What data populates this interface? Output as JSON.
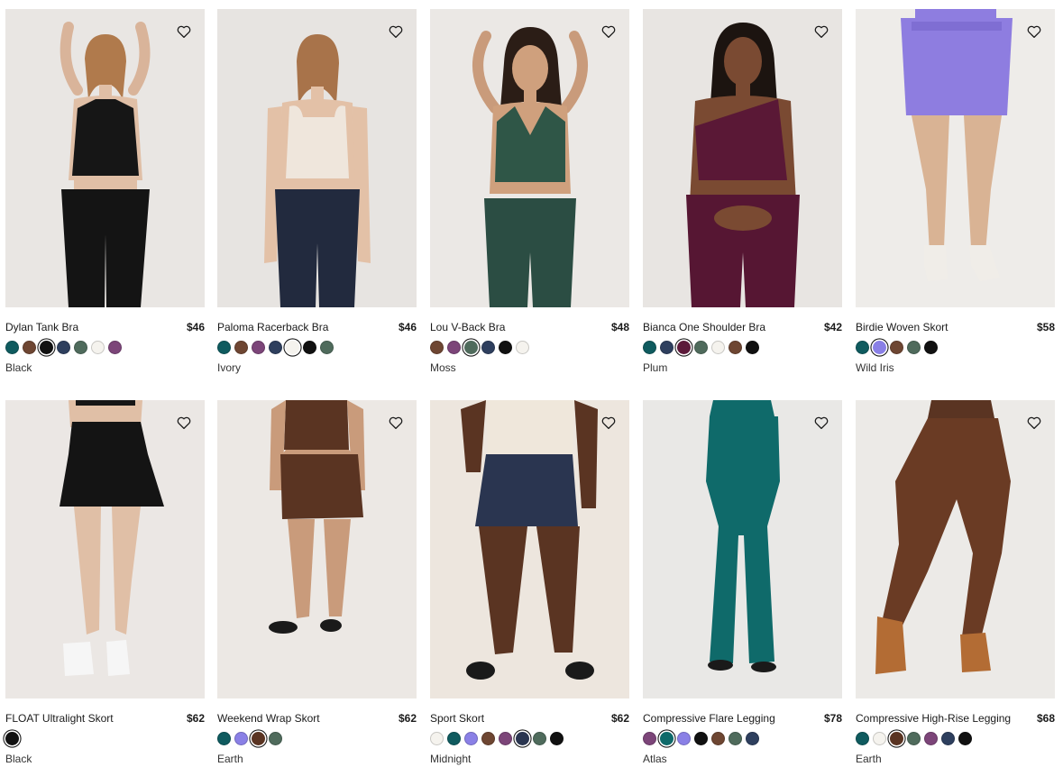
{
  "products": [
    {
      "name": "Dylan Tank Bra",
      "price": "$46",
      "color_name": "Black",
      "bg": "#e9e6e3",
      "swatches": [
        "#0f5b5f",
        "#6e4632",
        "#111111",
        "#2e3f5e",
        "#4f6b5c",
        "#f5f3ee",
        "#7c4579"
      ],
      "selected": 2
    },
    {
      "name": "Paloma Racerback Bra",
      "price": "$46",
      "color_name": "Ivory",
      "bg": "#e7e4e1",
      "swatches": [
        "#0f5b5f",
        "#6e4632",
        "#7c4579",
        "#2e3f5e",
        "#f5f3ee",
        "#111111",
        "#4f6b5c"
      ],
      "selected": 4
    },
    {
      "name": "Lou V-Back Bra",
      "price": "$48",
      "color_name": "Moss",
      "bg": "#ebe8e5",
      "swatches": [
        "#6e4632",
        "#7c4579",
        "#4f6b5c",
        "#2e3f5e",
        "#111111",
        "#f5f3ee"
      ],
      "selected": 2
    },
    {
      "name": "Bianca One Shoulder Bra",
      "price": "$42",
      "color_name": "Plum",
      "bg": "#e8e5e2",
      "swatches": [
        "#0f5b5f",
        "#2e3f5e",
        "#5c1a3a",
        "#4f6b5c",
        "#f5f3ee",
        "#6e4632",
        "#111111"
      ],
      "selected": 2
    },
    {
      "name": "Birdie Woven Skort",
      "price": "$58",
      "color_name": "Wild Iris",
      "bg": "#eeece9",
      "swatches": [
        "#0f5b5f",
        "#8a80e6",
        "#6e4632",
        "#4f6b5c",
        "#111111"
      ],
      "selected": 1
    },
    {
      "name": "FLOAT Ultralight Skort",
      "price": "$62",
      "color_name": "Black",
      "bg": "#ebe7e4",
      "swatches": [
        "#111111"
      ],
      "selected": 0
    },
    {
      "name": "Weekend Wrap Skort",
      "price": "$62",
      "color_name": "Earth",
      "bg": "#ece8e4",
      "swatches": [
        "#0f5b5f",
        "#8a80e6",
        "#5a3422",
        "#4f6b5c"
      ],
      "selected": 2
    },
    {
      "name": "Sport Skort",
      "price": "$62",
      "color_name": "Midnight",
      "bg": "#ede6de",
      "swatches": [
        "#f5f3ee",
        "#0f5b5f",
        "#8a80e6",
        "#6e4632",
        "#7c4579",
        "#2a3550",
        "#4f6b5c",
        "#111111"
      ],
      "selected": 5
    },
    {
      "name": "Compressive Flare Legging",
      "price": "$78",
      "color_name": "Atlas",
      "bg": "#e9e8e6",
      "swatches": [
        "#7c4579",
        "#0f6a6a",
        "#8a80e6",
        "#111111",
        "#6e4632",
        "#4f6b5c",
        "#2e3f5e"
      ],
      "selected": 1
    },
    {
      "name": "Compressive High-Rise Legging",
      "price": "$68",
      "color_name": "Earth",
      "bg": "#eceae7",
      "swatches": [
        "#0f5b5f",
        "#f5f3ee",
        "#5a3422",
        "#4f6b5c",
        "#7c4579",
        "#2e3f5e",
        "#111111"
      ],
      "selected": 2
    }
  ]
}
